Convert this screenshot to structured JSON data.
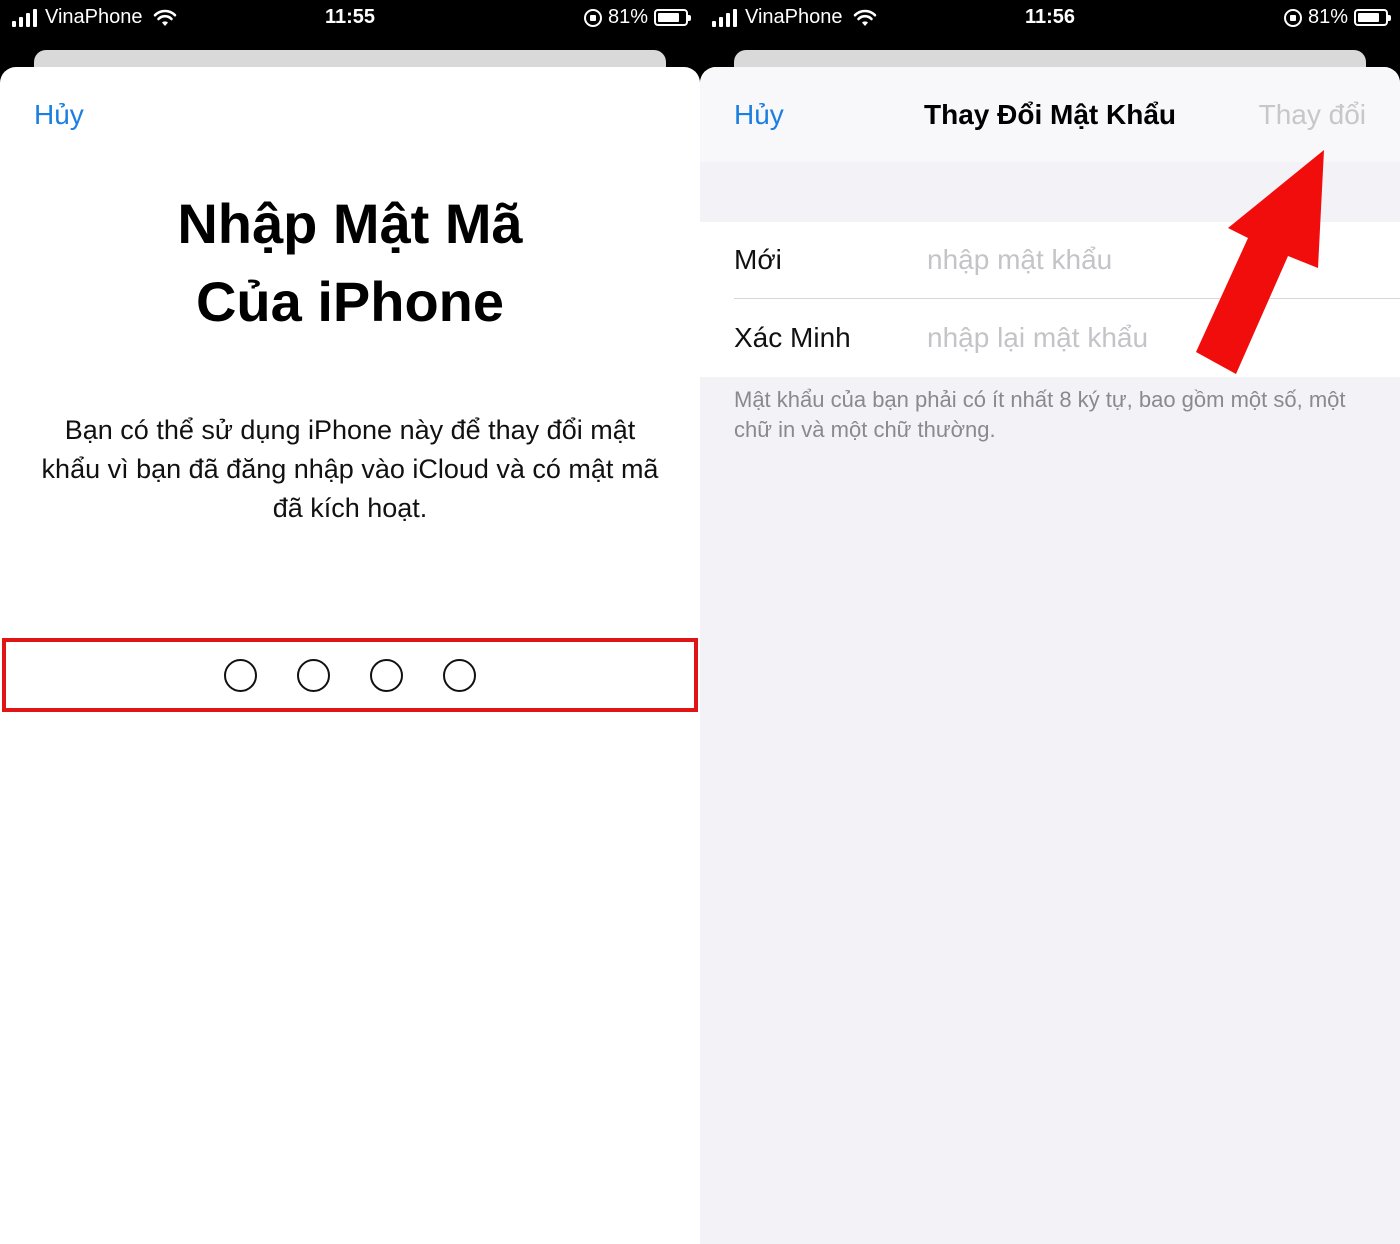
{
  "left_screen": {
    "status": {
      "carrier": "VinaPhone",
      "time": "11:55",
      "battery": "81%",
      "battery_level": 0.81
    },
    "cancel_label": "Hủy",
    "title_line1": "Nhập Mật Mã",
    "title_line2": "Của iPhone",
    "description": "Bạn có thể sử dụng iPhone này để thay đổi mật khẩu vì bạn đã đăng nhập vào iCloud và có mật mã đã kích hoạt.",
    "passcode_digits_total": 4,
    "passcode_digits_filled": 0,
    "highlight_color": "#e01616"
  },
  "right_screen": {
    "status": {
      "carrier": "VinaPhone",
      "time": "11:56",
      "battery": "81%",
      "battery_level": 0.81
    },
    "cancel_label": "Hủy",
    "nav_title": "Thay Đổi Mật Khẩu",
    "action_label": "Thay đổi",
    "fields": [
      {
        "label": "Mới",
        "value": "",
        "placeholder": "nhập mật khẩu"
      },
      {
        "label": "Xác Minh",
        "value": "",
        "placeholder": "nhập lại mật khẩu"
      }
    ],
    "footnote": "Mật khẩu của bạn phải có ít nhất 8 ký tự, bao gồm một số, một chữ in và một chữ thường.",
    "arrow_color": "#f20d0d"
  },
  "colors": {
    "ios_blue": "#1a7fe0",
    "disabled_gray": "#c6c6cb",
    "grouped_background": "#f2f2f7"
  }
}
